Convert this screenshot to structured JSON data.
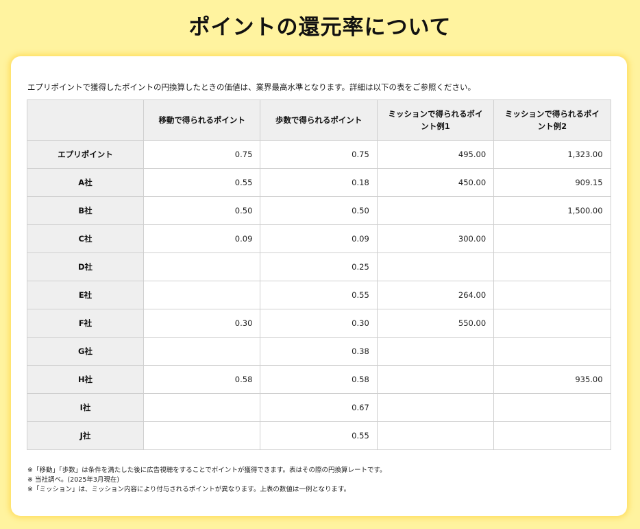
{
  "title": "ポイントの還元率について",
  "intro": "エプリポイントで獲得したポイントの円換算したときの価値は、業界最高水準となります。詳細は以下の表をご参照ください。",
  "table": {
    "headers": [
      "",
      "移動で得られるポイント",
      "歩数で得られるポイント",
      "ミッションで得られるポイント例1",
      "ミッションで得られるポイント例2"
    ],
    "rows": [
      {
        "name": "エプリポイント",
        "values": [
          "0.75",
          "0.75",
          "495.00",
          "1,323.00"
        ]
      },
      {
        "name": "A社",
        "values": [
          "0.55",
          "0.18",
          "450.00",
          "909.15"
        ]
      },
      {
        "name": "B社",
        "values": [
          "0.50",
          "0.50",
          "",
          "1,500.00"
        ]
      },
      {
        "name": "C社",
        "values": [
          "0.09",
          "0.09",
          "300.00",
          ""
        ]
      },
      {
        "name": "D社",
        "values": [
          "",
          "0.25",
          "",
          ""
        ]
      },
      {
        "name": "E社",
        "values": [
          "",
          "0.55",
          "264.00",
          ""
        ]
      },
      {
        "name": "F社",
        "values": [
          "0.30",
          "0.30",
          "550.00",
          ""
        ]
      },
      {
        "name": "G社",
        "values": [
          "",
          "0.38",
          "",
          ""
        ]
      },
      {
        "name": "H社",
        "values": [
          "0.58",
          "0.58",
          "",
          "935.00"
        ]
      },
      {
        "name": "I社",
        "values": [
          "",
          "0.67",
          "",
          ""
        ]
      },
      {
        "name": "J社",
        "values": [
          "",
          "0.55",
          "",
          ""
        ]
      }
    ]
  },
  "notes": [
    "※「移動」「歩数」は条件を満たした後に広告視聴をすることでポイントが獲得できます。表はその際の円換算レートです。",
    "※ 当社調べ。(2025年3月現在)",
    "※「ミッション」は、ミッション内容により付与されるポイントが異なります。上表の数値は一例となります。"
  ]
}
